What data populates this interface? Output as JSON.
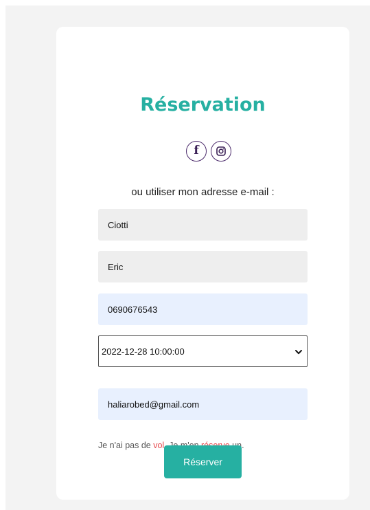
{
  "form": {
    "title": "Réservation",
    "subtitle": "ou utiliser mon adresse e-mail :",
    "nom_value": "Ciotti",
    "prenom_value": "Eric",
    "telephone_value": "0690676543",
    "datetime_selected": "2022-12-28 10:00:00",
    "email_value": "haliarobed@gmail.com",
    "note": {
      "part1": "Je n'ai pas de ",
      "link1": "vol",
      "part2": ". Je m'en ",
      "link2": "réserve",
      "part3": " un."
    },
    "submit_label": "Réserver"
  },
  "social": {
    "facebook_icon": "facebook-icon",
    "facebook_glyph": "f",
    "instagram_icon": "instagram-icon"
  },
  "colors": {
    "accent": "#26b0a2",
    "link": "#e5484d",
    "autofill_bg": "#e8f0fe",
    "input_bg": "#eeeeee",
    "page_bg": "#f3f3f3"
  }
}
